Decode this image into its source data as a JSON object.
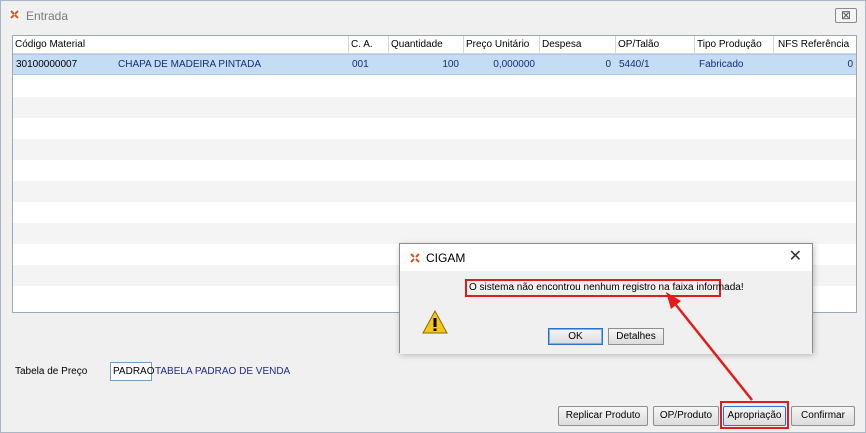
{
  "window": {
    "title": "Entrada",
    "close_label": "⊠"
  },
  "grid": {
    "columns": [
      "Código Material",
      "C. A.",
      "Quantidade",
      "Preço Unitário",
      "Despesa",
      "OP/Talão",
      "Tipo Produção",
      "NFS Referência"
    ],
    "rows": [
      {
        "codigo": "30100000007",
        "descricao": "CHAPA DE MADEIRA PINTADA",
        "ca": "001",
        "quantidade": "100",
        "preco": "0,000000",
        "despesa": "0",
        "op": "5440/1",
        "tipo": "Fabricado",
        "nfs": "0"
      }
    ]
  },
  "price_table": {
    "label": "Tabela de Preço",
    "code": "PADRAO",
    "description": "TABELA PADRAO DE VENDA"
  },
  "buttons": {
    "replicar": "Replicar Produto",
    "op_produto": "OP/Produto",
    "apropriacao": "Apropriação",
    "confirmar": "Confirmar"
  },
  "dialog": {
    "title": "CIGAM",
    "message": "O sistema não encontrou nenhum registro na faixa informada!",
    "ok": "OK",
    "details": "Detalhes"
  },
  "colors": {
    "highlight": "#e21b1b",
    "selected_row": "#c5dcf5"
  }
}
